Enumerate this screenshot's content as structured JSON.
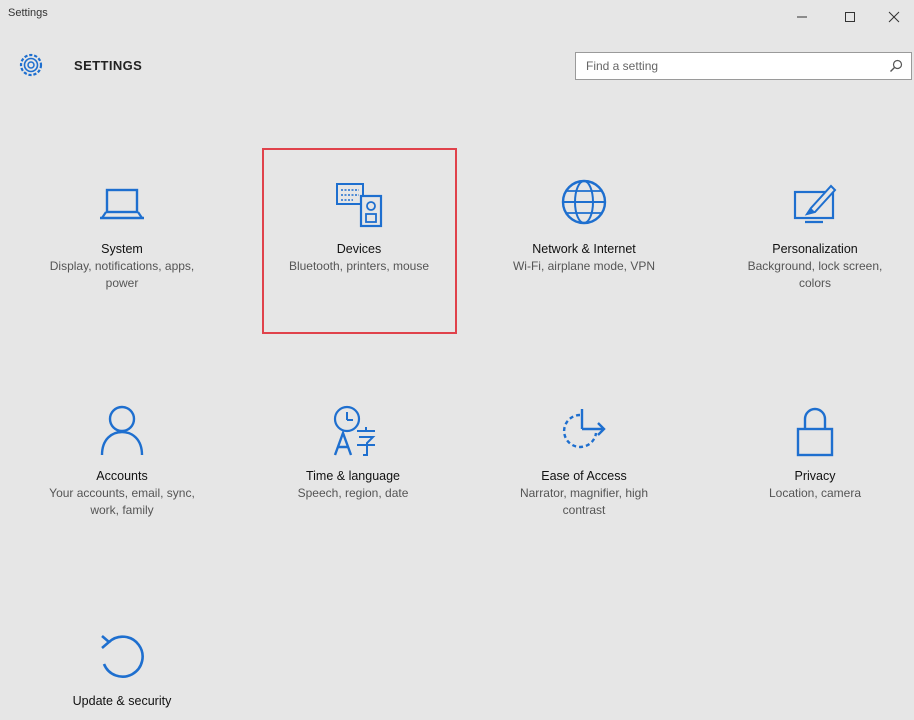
{
  "window": {
    "title": "Settings"
  },
  "header": {
    "heading": "SETTINGS"
  },
  "search": {
    "placeholder": "Find a setting"
  },
  "accent_color": "#1e6fcf",
  "highlight_color": "#e0424b",
  "tiles": [
    {
      "icon": "laptop-icon",
      "title": "System",
      "desc": "Display, notifications, apps, power"
    },
    {
      "icon": "devices-icon",
      "title": "Devices",
      "desc": "Bluetooth, printers, mouse"
    },
    {
      "icon": "globe-icon",
      "title": "Network & Internet",
      "desc": "Wi-Fi, airplane mode, VPN"
    },
    {
      "icon": "paint-icon",
      "title": "Personalization",
      "desc": "Background, lock screen, colors"
    },
    {
      "icon": "person-icon",
      "title": "Accounts",
      "desc": "Your accounts, email, sync, work, family"
    },
    {
      "icon": "time-language-icon",
      "title": "Time & language",
      "desc": "Speech, region, date"
    },
    {
      "icon": "ease-of-access-icon",
      "title": "Ease of Access",
      "desc": "Narrator, magnifier, high contrast"
    },
    {
      "icon": "lock-icon",
      "title": "Privacy",
      "desc": "Location, camera"
    },
    {
      "icon": "update-icon",
      "title": "Update & security",
      "desc": ""
    }
  ]
}
